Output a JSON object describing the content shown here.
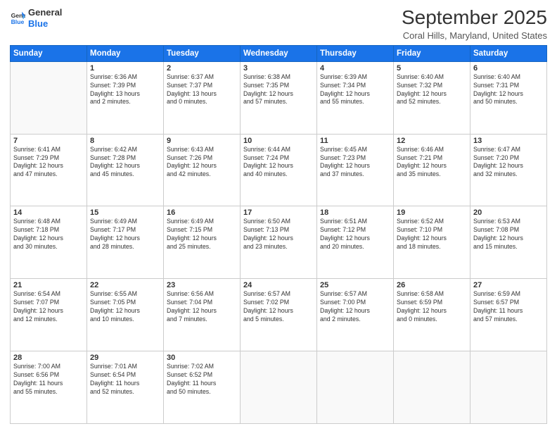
{
  "header": {
    "logo_line1": "General",
    "logo_line2": "Blue",
    "title": "September 2025",
    "subtitle": "Coral Hills, Maryland, United States"
  },
  "days_of_week": [
    "Sunday",
    "Monday",
    "Tuesday",
    "Wednesday",
    "Thursday",
    "Friday",
    "Saturday"
  ],
  "weeks": [
    [
      {
        "day": "",
        "info": ""
      },
      {
        "day": "1",
        "info": "Sunrise: 6:36 AM\nSunset: 7:39 PM\nDaylight: 13 hours\nand 2 minutes."
      },
      {
        "day": "2",
        "info": "Sunrise: 6:37 AM\nSunset: 7:37 PM\nDaylight: 13 hours\nand 0 minutes."
      },
      {
        "day": "3",
        "info": "Sunrise: 6:38 AM\nSunset: 7:35 PM\nDaylight: 12 hours\nand 57 minutes."
      },
      {
        "day": "4",
        "info": "Sunrise: 6:39 AM\nSunset: 7:34 PM\nDaylight: 12 hours\nand 55 minutes."
      },
      {
        "day": "5",
        "info": "Sunrise: 6:40 AM\nSunset: 7:32 PM\nDaylight: 12 hours\nand 52 minutes."
      },
      {
        "day": "6",
        "info": "Sunrise: 6:40 AM\nSunset: 7:31 PM\nDaylight: 12 hours\nand 50 minutes."
      }
    ],
    [
      {
        "day": "7",
        "info": "Sunrise: 6:41 AM\nSunset: 7:29 PM\nDaylight: 12 hours\nand 47 minutes."
      },
      {
        "day": "8",
        "info": "Sunrise: 6:42 AM\nSunset: 7:28 PM\nDaylight: 12 hours\nand 45 minutes."
      },
      {
        "day": "9",
        "info": "Sunrise: 6:43 AM\nSunset: 7:26 PM\nDaylight: 12 hours\nand 42 minutes."
      },
      {
        "day": "10",
        "info": "Sunrise: 6:44 AM\nSunset: 7:24 PM\nDaylight: 12 hours\nand 40 minutes."
      },
      {
        "day": "11",
        "info": "Sunrise: 6:45 AM\nSunset: 7:23 PM\nDaylight: 12 hours\nand 37 minutes."
      },
      {
        "day": "12",
        "info": "Sunrise: 6:46 AM\nSunset: 7:21 PM\nDaylight: 12 hours\nand 35 minutes."
      },
      {
        "day": "13",
        "info": "Sunrise: 6:47 AM\nSunset: 7:20 PM\nDaylight: 12 hours\nand 32 minutes."
      }
    ],
    [
      {
        "day": "14",
        "info": "Sunrise: 6:48 AM\nSunset: 7:18 PM\nDaylight: 12 hours\nand 30 minutes."
      },
      {
        "day": "15",
        "info": "Sunrise: 6:49 AM\nSunset: 7:17 PM\nDaylight: 12 hours\nand 28 minutes."
      },
      {
        "day": "16",
        "info": "Sunrise: 6:49 AM\nSunset: 7:15 PM\nDaylight: 12 hours\nand 25 minutes."
      },
      {
        "day": "17",
        "info": "Sunrise: 6:50 AM\nSunset: 7:13 PM\nDaylight: 12 hours\nand 23 minutes."
      },
      {
        "day": "18",
        "info": "Sunrise: 6:51 AM\nSunset: 7:12 PM\nDaylight: 12 hours\nand 20 minutes."
      },
      {
        "day": "19",
        "info": "Sunrise: 6:52 AM\nSunset: 7:10 PM\nDaylight: 12 hours\nand 18 minutes."
      },
      {
        "day": "20",
        "info": "Sunrise: 6:53 AM\nSunset: 7:08 PM\nDaylight: 12 hours\nand 15 minutes."
      }
    ],
    [
      {
        "day": "21",
        "info": "Sunrise: 6:54 AM\nSunset: 7:07 PM\nDaylight: 12 hours\nand 12 minutes."
      },
      {
        "day": "22",
        "info": "Sunrise: 6:55 AM\nSunset: 7:05 PM\nDaylight: 12 hours\nand 10 minutes."
      },
      {
        "day": "23",
        "info": "Sunrise: 6:56 AM\nSunset: 7:04 PM\nDaylight: 12 hours\nand 7 minutes."
      },
      {
        "day": "24",
        "info": "Sunrise: 6:57 AM\nSunset: 7:02 PM\nDaylight: 12 hours\nand 5 minutes."
      },
      {
        "day": "25",
        "info": "Sunrise: 6:57 AM\nSunset: 7:00 PM\nDaylight: 12 hours\nand 2 minutes."
      },
      {
        "day": "26",
        "info": "Sunrise: 6:58 AM\nSunset: 6:59 PM\nDaylight: 12 hours\nand 0 minutes."
      },
      {
        "day": "27",
        "info": "Sunrise: 6:59 AM\nSunset: 6:57 PM\nDaylight: 11 hours\nand 57 minutes."
      }
    ],
    [
      {
        "day": "28",
        "info": "Sunrise: 7:00 AM\nSunset: 6:56 PM\nDaylight: 11 hours\nand 55 minutes."
      },
      {
        "day": "29",
        "info": "Sunrise: 7:01 AM\nSunset: 6:54 PM\nDaylight: 11 hours\nand 52 minutes."
      },
      {
        "day": "30",
        "info": "Sunrise: 7:02 AM\nSunset: 6:52 PM\nDaylight: 11 hours\nand 50 minutes."
      },
      {
        "day": "",
        "info": ""
      },
      {
        "day": "",
        "info": ""
      },
      {
        "day": "",
        "info": ""
      },
      {
        "day": "",
        "info": ""
      }
    ]
  ]
}
